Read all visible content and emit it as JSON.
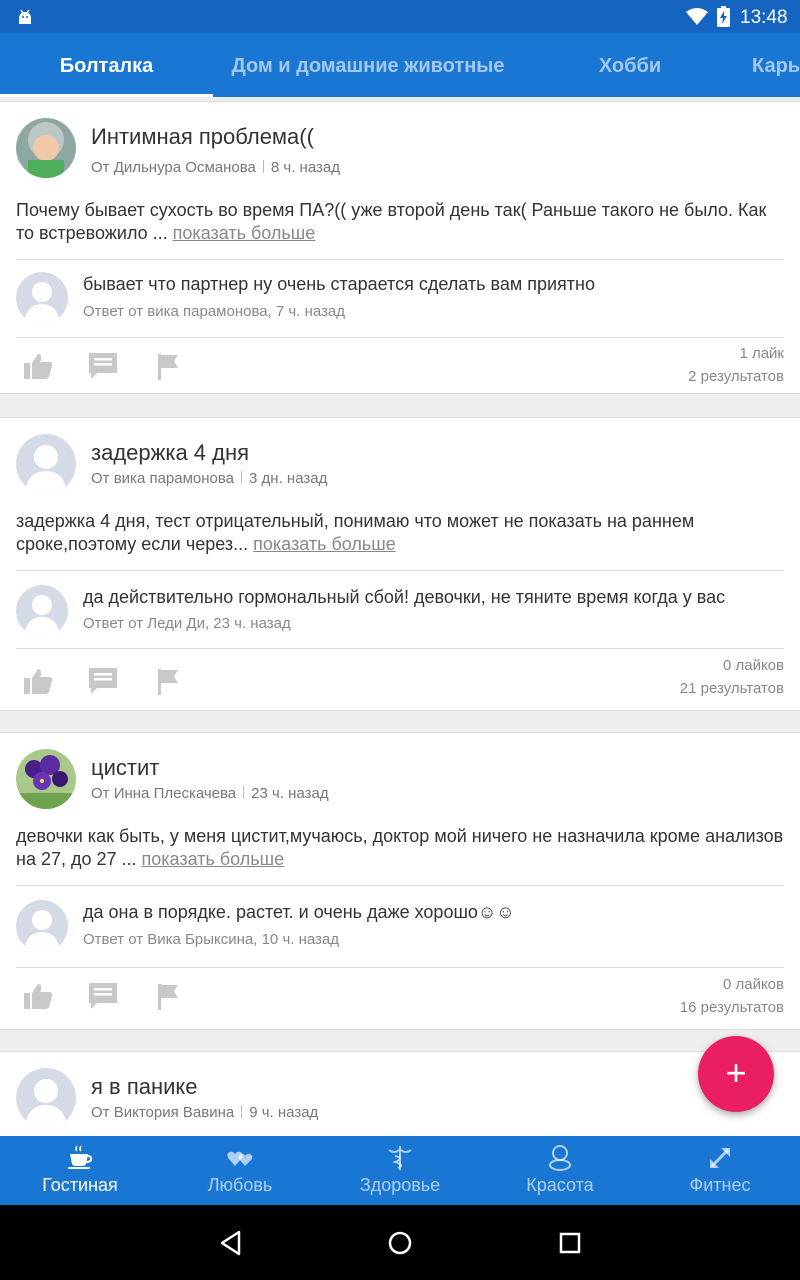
{
  "status_bar": {
    "time": "13:48"
  },
  "tabs": [
    {
      "label": "Болталка",
      "active": true
    },
    {
      "label": "Дом и домашние животные",
      "active": false
    },
    {
      "label": "Хобби",
      "active": false
    },
    {
      "label": "Карь",
      "active": false
    }
  ],
  "posts": [
    {
      "title": "Интимная проблема((",
      "author": "От Дильнура Османова",
      "time": "8 ч. назад",
      "body": "Почему бывает сухость во время ПА?(( уже второй день так( Раньше такого не было. Как то встревожило ... ",
      "more": "показать больше",
      "reply_text": "бывает что партнер ну очень старается сделать вам приятно",
      "reply_meta": "Ответ от вика парамонова, 7 ч. назад",
      "likes": "1 лайк",
      "results": "2 результатов",
      "avatar_icon": "photo-child-avatar"
    },
    {
      "title": "задержка 4 дня",
      "author": "От вика парамонова",
      "time": "3 дн. назад",
      "body": "задержка 4 дня, тест отрицательный, понимаю что может не показать на раннем сроке,поэтому если через... ",
      "more": "показать больше",
      "reply_text": "да действительно гормональный сбой!  девочки, не тяните время когда у вас",
      "reply_meta": "Ответ от Леди Ди, 23 ч. назад",
      "likes": "0 лайков",
      "results": "21 результатов",
      "avatar_icon": "default-user-avatar"
    },
    {
      "title": "цистит",
      "author": "От Инна Плескачева",
      "time": "23 ч. назад",
      "body": "девочки как быть, у меня цистит,мучаюсь, доктор мой ничего не назначила кроме анализов на 27, до 27 ... ",
      "more": "показать больше",
      "reply_text": "да она в порядке. растет. и очень даже хорошо☺☺",
      "reply_meta": "Ответ от Вика Брыксина, 10 ч. назад",
      "likes": "0 лайков",
      "results": "16 результатов",
      "avatar_icon": "photo-flowers-avatar"
    },
    {
      "title": "я в панике",
      "author": "От Виктория Вавина",
      "time": "9 ч. назад",
      "avatar_icon": "default-user-avatar"
    }
  ],
  "fab": {
    "label": "+"
  },
  "bottom_nav": [
    {
      "label": "Гостиная",
      "icon": "coffee-cup-icon",
      "active": true
    },
    {
      "label": "Любовь",
      "icon": "hearts-icon",
      "active": false
    },
    {
      "label": "Здоровье",
      "icon": "caduceus-icon",
      "active": false
    },
    {
      "label": "Красота",
      "icon": "mirror-icon",
      "active": false
    },
    {
      "label": "Фитнес",
      "icon": "expand-arrows-icon",
      "active": false
    }
  ],
  "colors": {
    "primary": "#1976d2",
    "status_bar": "#1565c0",
    "accent": "#e91e63"
  }
}
